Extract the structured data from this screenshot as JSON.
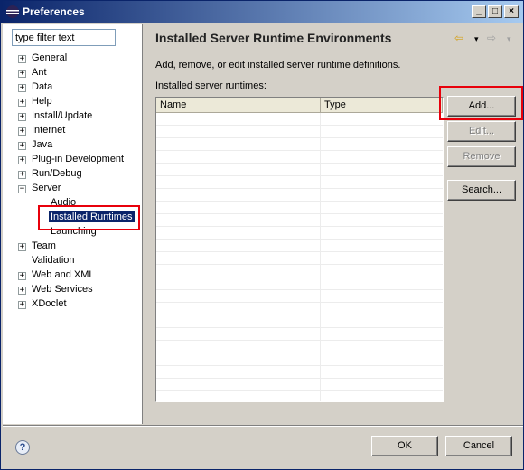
{
  "window": {
    "title": "Preferences"
  },
  "filter": {
    "value": "type filter text"
  },
  "tree": [
    {
      "label": "General"
    },
    {
      "label": "Ant"
    },
    {
      "label": "Data"
    },
    {
      "label": "Help"
    },
    {
      "label": "Install/Update"
    },
    {
      "label": "Internet"
    },
    {
      "label": "Java"
    },
    {
      "label": "Plug-in Development"
    },
    {
      "label": "Run/Debug"
    },
    {
      "label": "Server"
    },
    {
      "label": "Audio"
    },
    {
      "label": "Installed Runtimes"
    },
    {
      "label": "Launching"
    },
    {
      "label": "Team"
    },
    {
      "label": "Validation"
    },
    {
      "label": "Web and XML"
    },
    {
      "label": "Web Services"
    },
    {
      "label": "XDoclet"
    }
  ],
  "page": {
    "title": "Installed Server Runtime Environments",
    "description": "Add, remove, or edit installed server runtime definitions.",
    "table_label": "Installed server runtimes:",
    "columns": [
      "Name",
      "Type"
    ]
  },
  "buttons": {
    "add": "Add...",
    "edit": "Edit...",
    "remove": "Remove",
    "search": "Search...",
    "ok": "OK",
    "cancel": "Cancel"
  },
  "colors": {
    "highlight": "#e8000b",
    "selection": "#0a246a"
  }
}
